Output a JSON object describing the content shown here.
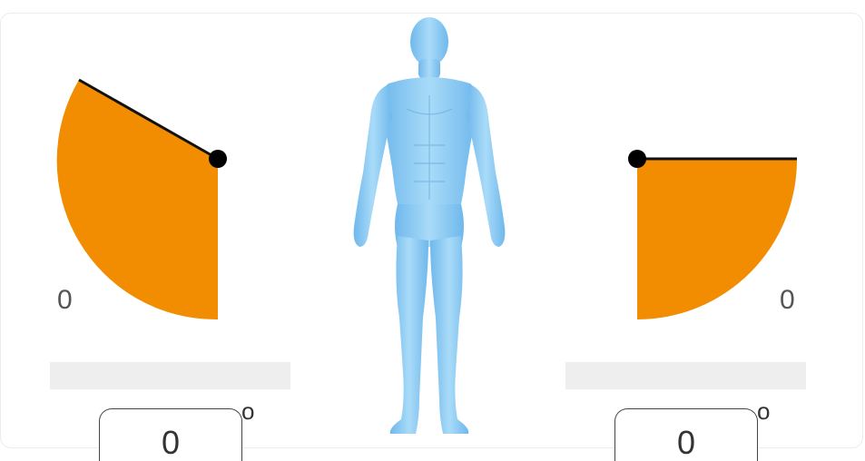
{
  "left_joint": {
    "corner_label": "0",
    "input_value": "0",
    "degree_symbol": "o",
    "fill_color": "#F28C00"
  },
  "right_joint": {
    "corner_label": "0",
    "input_value": "0",
    "degree_symbol": "o",
    "fill_color": "#F28C00"
  },
  "figure": {
    "icon": "human-body-icon",
    "color": "#8CCBF2"
  }
}
